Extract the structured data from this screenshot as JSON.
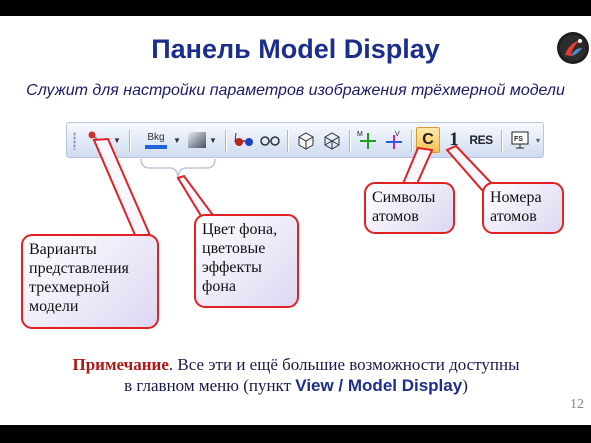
{
  "slide": {
    "title": "Панель Model Display",
    "subtitle": "Служит для настройки параметров изображения  трёхмерной модели",
    "page_number": "12"
  },
  "toolbar": {
    "buttons": [
      {
        "icon": "ball-and-stick-model-icon"
      },
      {
        "icon": "background-color-icon",
        "label": "Bkg"
      },
      {
        "icon": "gradient-effect-icon"
      },
      {
        "icon": "stereo-glasses-icon"
      },
      {
        "icon": "perspective-icon"
      },
      {
        "icon": "cube-box-icon"
      },
      {
        "icon": "rotate-axes-icon"
      },
      {
        "icon": "move-axes-icon"
      },
      {
        "icon": "atom-symbols-button",
        "label": "C"
      },
      {
        "icon": "atom-numbers-button",
        "label": "1"
      },
      {
        "icon": "residue-labels-button",
        "label": "RES"
      },
      {
        "icon": "full-screen-icon",
        "label": "FS"
      }
    ]
  },
  "callouts": {
    "model_variants": "Варианты представления трехмерной модели",
    "background": "Цвет фона, цветовые эффекты фона",
    "atom_symbols": "Символы атомов",
    "atom_numbers": "Номера атомов"
  },
  "note": {
    "label": "Примечание",
    "text_line1": ". Все эти и ещё большие возможности доступны",
    "text_line2": "в главном меню (пункт ",
    "menu_path": "View / Model Display",
    "text_end": ")"
  },
  "colors": {
    "title": "#1c2e8c",
    "callout_border": "#e02222",
    "note_label": "#b01818"
  }
}
